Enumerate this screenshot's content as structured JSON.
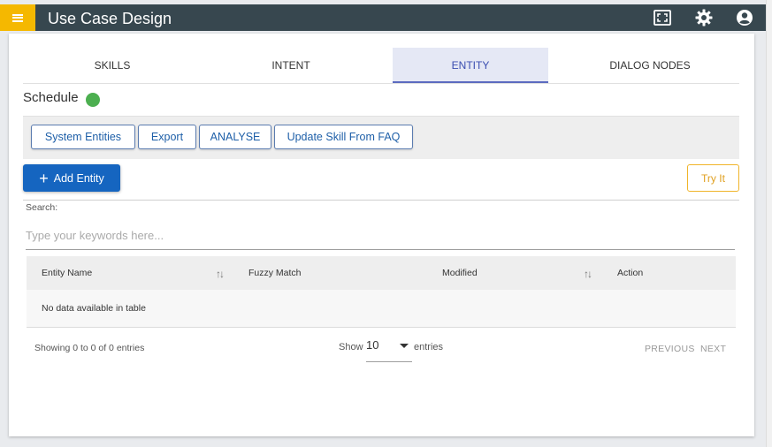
{
  "header": {
    "title": "Use Case Design",
    "menu_icon": "hamburger-icon",
    "icons": [
      "fullscreen-icon",
      "gear-icon",
      "account-icon"
    ]
  },
  "tabs": [
    {
      "label": "SKILLS",
      "active": false
    },
    {
      "label": "INTENT",
      "active": false
    },
    {
      "label": "ENTITY",
      "active": true
    },
    {
      "label": "DIALOG NODES",
      "active": false
    }
  ],
  "skill": {
    "name": "Schedule",
    "status_color": "#4caf50"
  },
  "toolbar": {
    "system_entities": "System Entities",
    "export": "Export",
    "analyse": "ANALYSE",
    "update_from_faq": "Update Skill From FAQ"
  },
  "actions": {
    "add_entity": "Add Entity",
    "try_it": "Try It"
  },
  "search": {
    "label": "Search:",
    "placeholder": "Type your keywords here...",
    "value": ""
  },
  "table": {
    "columns": [
      "Entity Name",
      "Fuzzy Match",
      "Modified",
      "Action"
    ],
    "empty_message": "No data available in table"
  },
  "pagination": {
    "info": "Showing 0 to 0 of 0 entries",
    "show_label": "Show",
    "page_size": "10",
    "entries_label": "entries",
    "previous": "PREVIOUS",
    "next": "NEXT"
  },
  "colors": {
    "topbar": "#37474f",
    "menu_accent": "#f5b800",
    "primary": "#1565c0",
    "try_accent": "#f0b429"
  }
}
